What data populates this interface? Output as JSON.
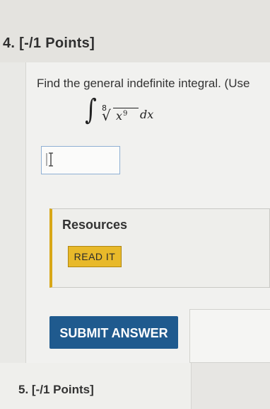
{
  "question": {
    "title": "4. [-/1 Points]",
    "prompt": "Find the general indefinite integral. (Use",
    "integral": {
      "sign": "∫",
      "root_index": "8",
      "radical": "√",
      "radicand": "x",
      "exponent": "9",
      "differential": "dx"
    },
    "answer_value": ""
  },
  "resources": {
    "title": "Resources",
    "read_it_label": "READ IT"
  },
  "submit_label": "SUBMIT ANSWER",
  "next_question": {
    "title": "5. [-/1 Points]"
  },
  "colors": {
    "submit_bg": "#1f5a8e",
    "read_it_bg": "#e8b92a",
    "resources_accent": "#d8a717",
    "answer_border": "#8fb0d4"
  }
}
